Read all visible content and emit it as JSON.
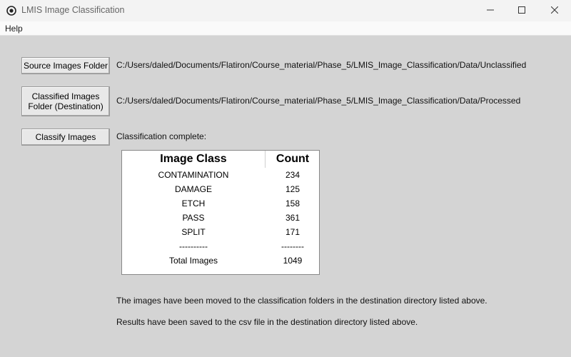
{
  "window": {
    "title": "LMIS Image Classification"
  },
  "menu": {
    "items": [
      "Help"
    ]
  },
  "controls": {
    "source_button": "Source Images Folder",
    "dest_button_line1": "Classified Images",
    "dest_button_line2": "Folder (Destination)",
    "classify_button": "Classify Images",
    "source_path": "C:/Users/daled/Documents/Flatiron/Course_material/Phase_5/LMIS_Image_Classification/Data/Unclassified",
    "dest_path": "C:/Users/daled/Documents/Flatiron/Course_material/Phase_5/LMIS_Image_Classification/Data/Processed",
    "status": "Classification complete:"
  },
  "results": {
    "header_class": "Image Class",
    "header_count": "Count",
    "rows": [
      {
        "class": "CONTAMINATION",
        "count": "234"
      },
      {
        "class": "DAMAGE",
        "count": "125"
      },
      {
        "class": "ETCH",
        "count": "158"
      },
      {
        "class": "PASS",
        "count": "361"
      },
      {
        "class": "SPLIT",
        "count": "171"
      },
      {
        "class": "----------",
        "count": "--------"
      },
      {
        "class": "Total Images",
        "count": "1049"
      }
    ]
  },
  "messages": {
    "moved": "The images have been moved to the classification folders in the destination directory listed above.",
    "saved": "Results have been saved to the csv file in the destination directory listed above."
  },
  "icons": {
    "app": "app-eye-icon",
    "minimize": "minimize-icon",
    "maximize": "maximize-icon",
    "close": "close-icon"
  }
}
